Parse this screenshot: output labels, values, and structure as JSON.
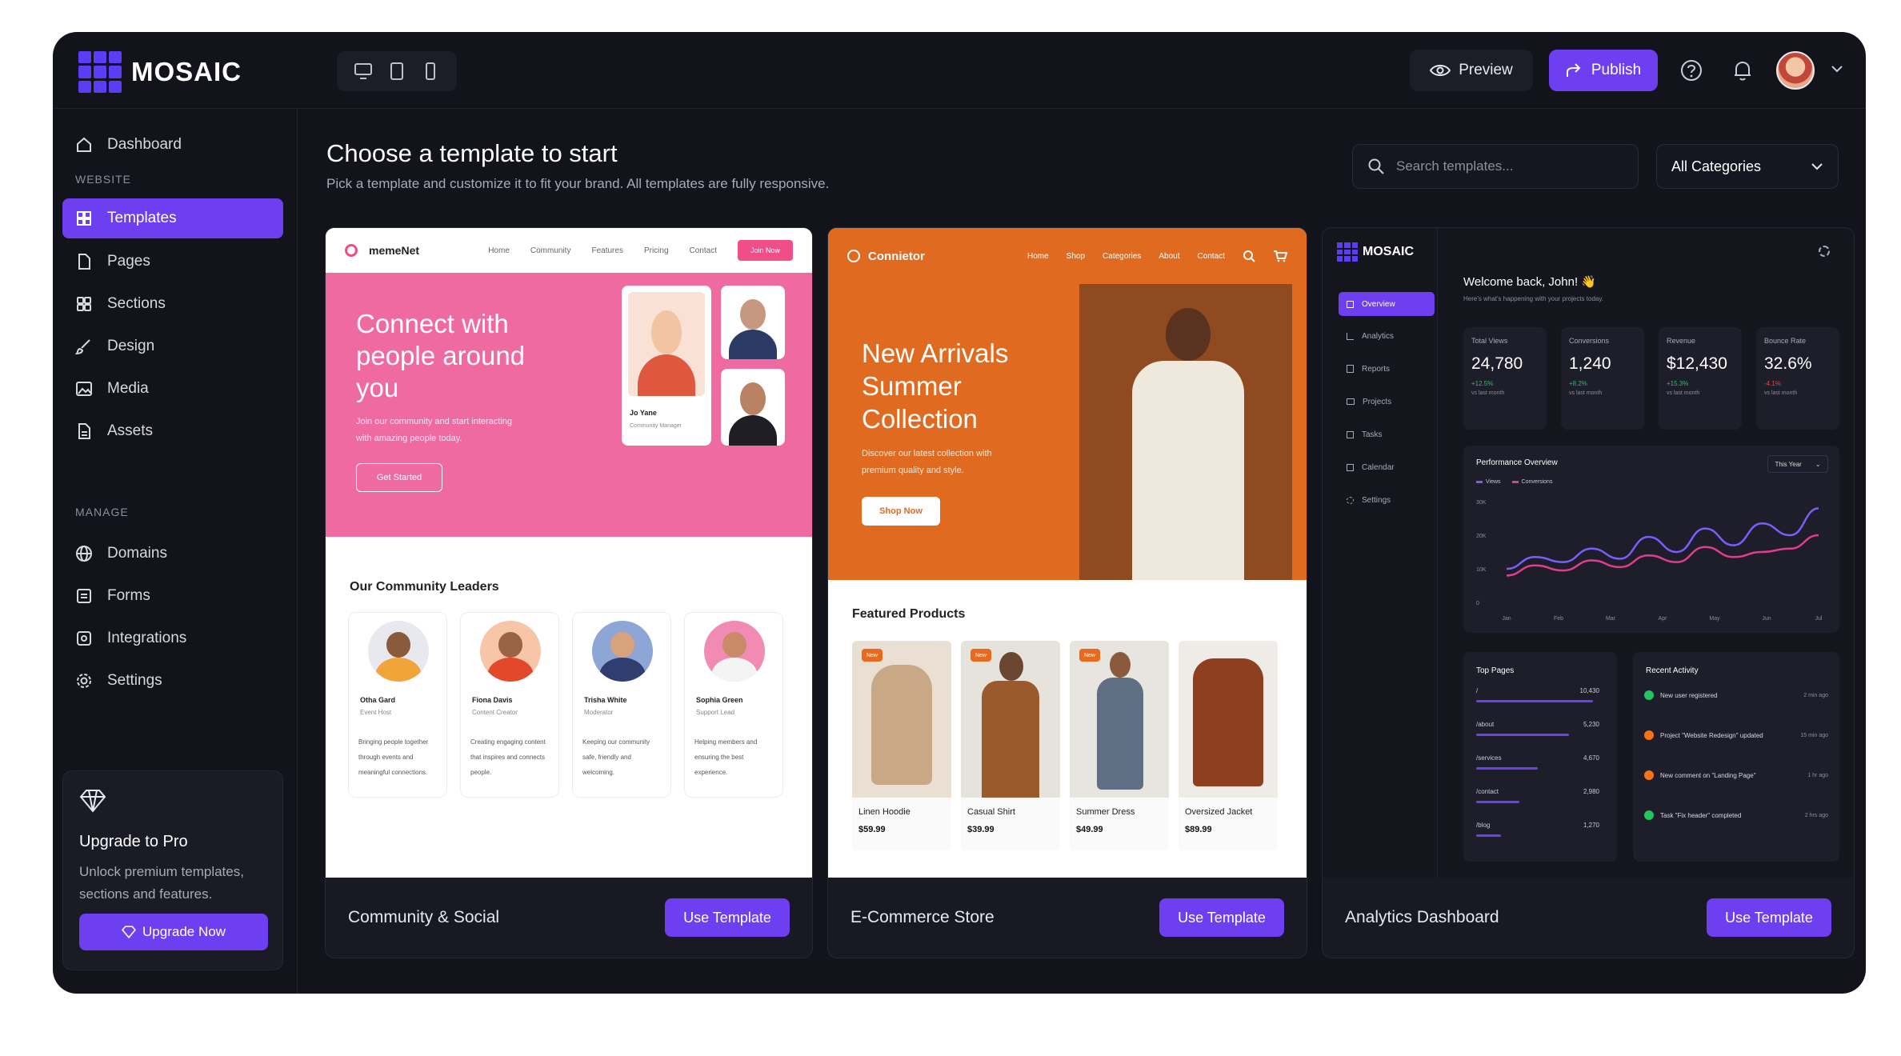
{
  "app": {
    "brand": "MOSAIC"
  },
  "header": {
    "preview_label": "Preview",
    "publish_label": "Publish"
  },
  "sidebar": {
    "items": [
      {
        "label": "Dashboard"
      }
    ],
    "website_section": "WEBSITE",
    "website_items": [
      {
        "label": "Templates",
        "active": true
      },
      {
        "label": "Pages"
      },
      {
        "label": "Sections"
      },
      {
        "label": "Design"
      },
      {
        "label": "Media"
      },
      {
        "label": "Assets"
      }
    ],
    "manage_section": "MANAGE",
    "manage_items": [
      {
        "label": "Domains"
      },
      {
        "label": "Forms"
      },
      {
        "label": "Integrations"
      },
      {
        "label": "Settings"
      }
    ],
    "upgrade": {
      "title": "Upgrade to Pro",
      "text": "Unlock premium templates, sections and features.",
      "button": "Upgrade Now"
    }
  },
  "main": {
    "title": "Choose a template to start",
    "subtitle": "Pick a template and customize it to fit your brand. All templates are fully responsive.",
    "search_placeholder": "Search templates...",
    "category_filter": "All Categories"
  },
  "templates": [
    {
      "name": "Community & Social",
      "button": "Use Template",
      "preview": {
        "brand": "memeNet",
        "nav": [
          "Home",
          "Community",
          "Features",
          "Pricing",
          "Contact"
        ],
        "nav_cta": "Join Now",
        "hero_title_1": "Connect with",
        "hero_title_2": "people around",
        "hero_title_3": "you",
        "hero_text_1": "Join our community and start interacting",
        "hero_text_2": "with amazing people today.",
        "hero_cta": "Get Started",
        "profile_name": "Jo Yane",
        "profile_role": "Community Manager",
        "section_title": "Our Community Leaders",
        "leaders": [
          {
            "name": "Otha Gard",
            "role": "Event Host",
            "desc": [
              "Bringing people together",
              "through events and",
              "meaningful connections."
            ]
          },
          {
            "name": "Fiona Davis",
            "role": "Content Creator",
            "desc": [
              "Creating engaging content",
              "that inspires and connects",
              "people."
            ]
          },
          {
            "name": "Trisha White",
            "role": "Moderator",
            "desc": [
              "Keeping our community",
              "safe, friendly and",
              "welcoming."
            ]
          },
          {
            "name": "Sophia Green",
            "role": "Support Lead",
            "desc": [
              "Helping members and",
              "ensuring the best",
              "experience."
            ]
          }
        ]
      }
    },
    {
      "name": "E-Commerce Store",
      "button": "Use Template",
      "preview": {
        "brand": "Connietor",
        "nav": [
          "Home",
          "Shop",
          "Categories",
          "About",
          "Contact"
        ],
        "hero_title_1": "New Arrivals",
        "hero_title_2": "Summer",
        "hero_title_3": "Collection",
        "hero_text_1": "Discover our latest collection with",
        "hero_text_2": "premium quality and style.",
        "hero_cta": "Shop Now",
        "section_title": "Featured Products",
        "new_tag": "New",
        "products": [
          {
            "name": "Linen Hoodie",
            "price": "$59.99",
            "new": true
          },
          {
            "name": "Casual Shirt",
            "price": "$39.99",
            "new": true
          },
          {
            "name": "Summer Dress",
            "price": "$49.99",
            "new": true
          },
          {
            "name": "Oversized Jacket",
            "price": "$89.99",
            "new": false
          }
        ]
      }
    },
    {
      "name": "Analytics Dashboard",
      "button": "Use Template",
      "preview": {
        "brand": "MOSAIC",
        "nav": [
          "Overview",
          "Analytics",
          "Reports",
          "Projects",
          "Tasks",
          "Calendar",
          "Settings"
        ],
        "welcome": "Welcome back, John! 👋",
        "welcome_sub": "Here's what's happening with your projects today.",
        "stats": [
          {
            "label": "Total Views",
            "value": "24,780",
            "delta": "+12.5%",
            "foot": "vs last month",
            "up": true
          },
          {
            "label": "Conversions",
            "value": "1,240",
            "delta": "+8.2%",
            "foot": "vs last month",
            "up": true
          },
          {
            "label": "Revenue",
            "value": "$12,430",
            "delta": "+15.3%",
            "foot": "vs last month",
            "up": true
          },
          {
            "label": "Bounce Rate",
            "value": "32.6%",
            "delta": "-4.1%",
            "foot": "vs last month",
            "up": false
          }
        ],
        "performance": {
          "title": "Performance Overview",
          "range": "This Year",
          "legend": [
            "Views",
            "Conversions"
          ]
        },
        "top_pages": {
          "title": "Top Pages",
          "rows": [
            {
              "path": "/",
              "value": "10,430",
              "share": 0.95
            },
            {
              "path": "/about",
              "value": "5,230",
              "share": 0.75
            },
            {
              "path": "/services",
              "value": "4,670",
              "share": 0.5
            },
            {
              "path": "/contact",
              "value": "2,980",
              "share": 0.35
            },
            {
              "path": "/blog",
              "value": "1,270",
              "share": 0.2
            }
          ]
        },
        "activity": {
          "title": "Recent Activity",
          "rows": [
            {
              "text": "New user registered",
              "time": "2 min ago",
              "color": "#22c55e"
            },
            {
              "text": "Project \"Website Redesign\" updated",
              "time": "15 min ago",
              "color": "#f97316"
            },
            {
              "text": "New comment on \"Landing Page\"",
              "time": "1 hr ago",
              "color": "#f97316"
            },
            {
              "text": "Task \"Fix header\" completed",
              "time": "2 hrs ago",
              "color": "#22c55e"
            }
          ]
        }
      }
    }
  ],
  "chart_data": {
    "type": "line",
    "title": "Performance Overview",
    "categories": [
      "Jan",
      "Feb",
      "Mar",
      "Apr",
      "May",
      "Jun",
      "Jul"
    ],
    "y_ticks": [
      "30K",
      "20K",
      "10K",
      "0"
    ],
    "ylim": [
      0,
      30000
    ],
    "legend": "top-left",
    "series": [
      {
        "name": "Views",
        "color": "#7c5cff",
        "values": [
          10000,
          13500,
          12000,
          16000,
          13000,
          19500,
          15000,
          22000,
          17000,
          23500,
          20000,
          28000
        ]
      },
      {
        "name": "Conversions",
        "color": "#e33b8f",
        "values": [
          8000,
          11000,
          9500,
          12500,
          10500,
          14000,
          12000,
          16500,
          13500,
          15000,
          16000,
          20000
        ]
      }
    ]
  }
}
